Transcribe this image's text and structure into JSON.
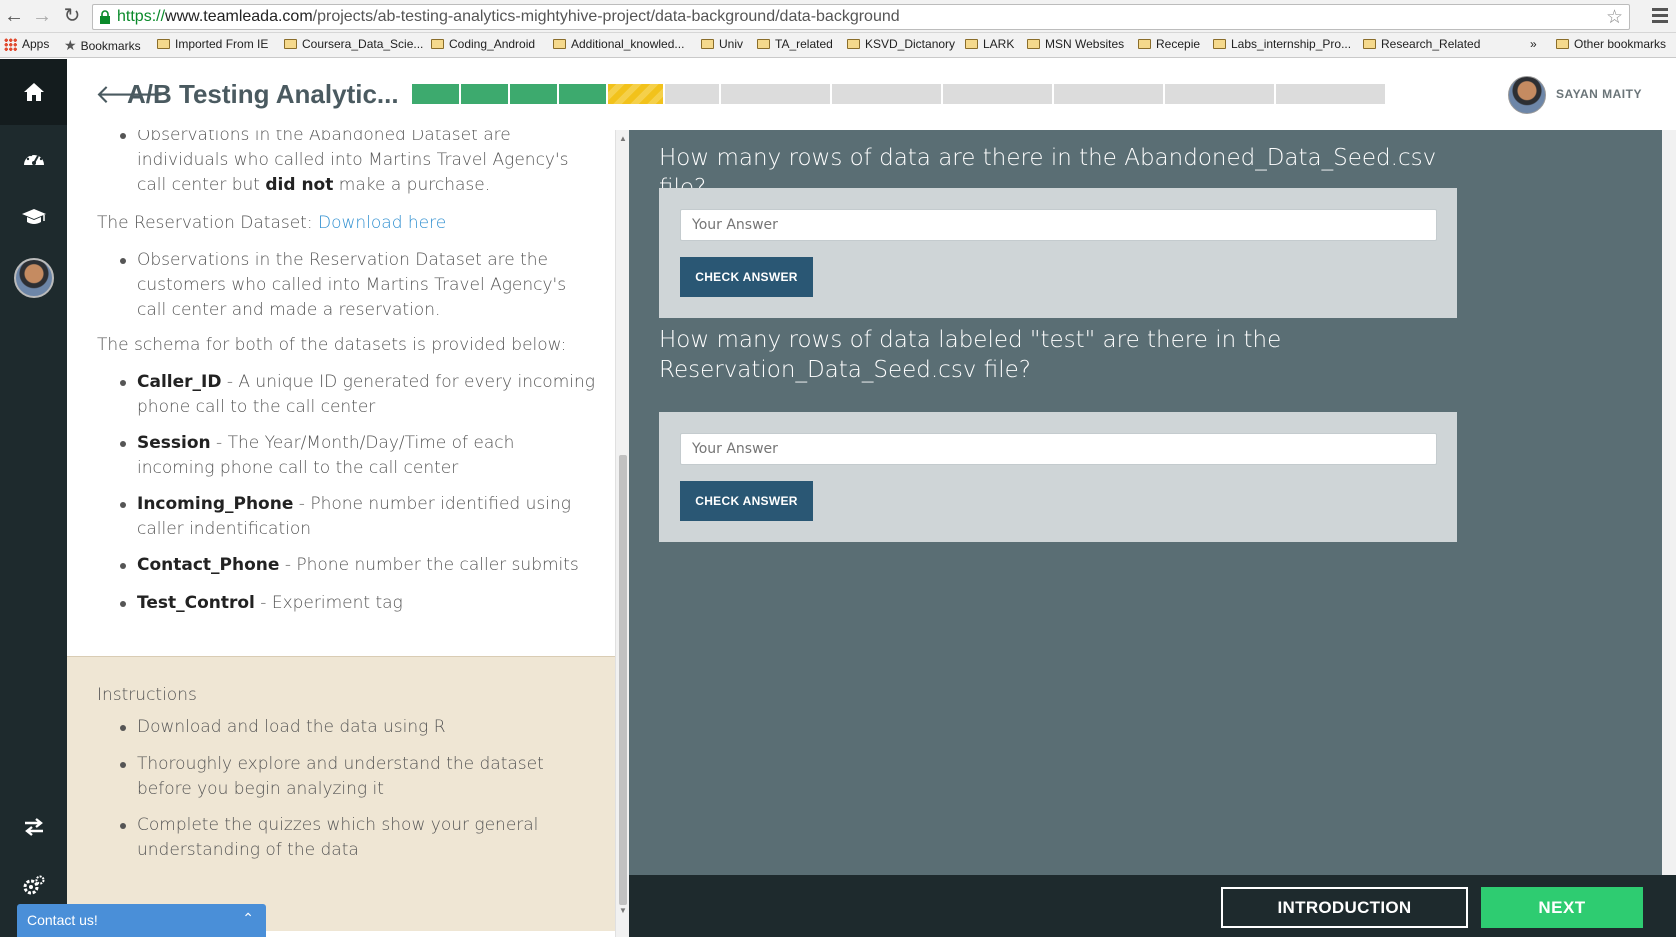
{
  "browser": {
    "url_prefix": "https://",
    "url_domain": "www.teamleada.com",
    "url_path": "/projects/ab-testing-analytics-mightyhive-project/data-background/data-background",
    "bookmarks": [
      "Apps",
      "Bookmarks",
      "Imported From IE",
      "Coursera_Data_Scie...",
      "Coding_Android",
      "Additional_knowled...",
      "Univ",
      "TA_related",
      "KSVD_Dictanory",
      "LARK",
      "MSN Websites",
      "Recepie",
      "Labs_internship_Pro...",
      "Research_Related",
      "»",
      "Other bookmarks"
    ]
  },
  "header": {
    "title": "A/B Testing Analytic...",
    "user_name": "SAYAN MAITY"
  },
  "progress": {
    "segments": [
      {
        "status": "done",
        "color": "#3daa6e"
      },
      {
        "status": "done",
        "color": "#3daa6e"
      },
      {
        "status": "done",
        "color": "#3daa6e"
      },
      {
        "status": "done",
        "color": "#3daa6e"
      },
      {
        "status": "current",
        "color": "#f2c21b"
      },
      {
        "status": "todo",
        "color": "#dcdcdc"
      },
      {
        "status": "todo",
        "color": "#dcdcdc"
      },
      {
        "status": "todo",
        "color": "#dcdcdc"
      },
      {
        "status": "todo",
        "color": "#dcdcdc"
      },
      {
        "status": "todo",
        "color": "#dcdcdc"
      },
      {
        "status": "todo",
        "color": "#dcdcdc"
      },
      {
        "status": "todo",
        "color": "#dcdcdc"
      }
    ]
  },
  "sidebar": {
    "icons": [
      "home-icon",
      "dashboard-icon",
      "graduation-cap-icon",
      "profile-avatar",
      "swap-icon",
      "settings-icon",
      "sign-out-icon"
    ]
  },
  "content": {
    "abandoned_obs_pre": "Observations in the Abandoned Dataset are individuals who called into Martins Travel Agency's call center but ",
    "abandoned_obs_bold": "did not",
    "abandoned_obs_post": " make a purchase.",
    "reservation_label": "The Reservation Dataset: ",
    "reservation_link": "Download here",
    "reservation_obs": "Observations in the Reservation Dataset are the customers who called into Martins Travel Agency's call center and made a reservation.",
    "schema_intro": "The schema for both of the datasets is provided below:",
    "schema": [
      {
        "field": "Caller_ID",
        "desc": " - A unique ID generated for every incoming phone call to the call center"
      },
      {
        "field": "Session",
        "desc": " - The Year/Month/Day/Time of each incoming phone call to the call center"
      },
      {
        "field": "Incoming_Phone",
        "desc": " - Phone number identified using caller indentification"
      },
      {
        "field": "Contact_Phone",
        "desc": " - Phone number the caller submits"
      },
      {
        "field": "Test_Control",
        "desc": " - Experiment tag"
      }
    ]
  },
  "instructions": {
    "title": "Instructions",
    "items": [
      "Download and load the data using R",
      "Thoroughly explore and understand the dataset before you begin analyzing it",
      "Complete the quizzes which show your general understanding of the data"
    ]
  },
  "contact": {
    "label": "Contact us!"
  },
  "quiz": {
    "questions": [
      {
        "text": "How many rows of data are there in the Abandoned_Data_Seed.csv file?",
        "placeholder": "Your Answer",
        "button": "CHECK ANSWER"
      },
      {
        "text": "How many rows of data labeled \"test\" are there in the Reservation_Data_Seed.csv file?",
        "placeholder": "Your Answer",
        "button": "CHECK ANSWER"
      }
    ]
  },
  "footer": {
    "intro_label": "INTRODUCTION",
    "next_label": "NEXT"
  }
}
